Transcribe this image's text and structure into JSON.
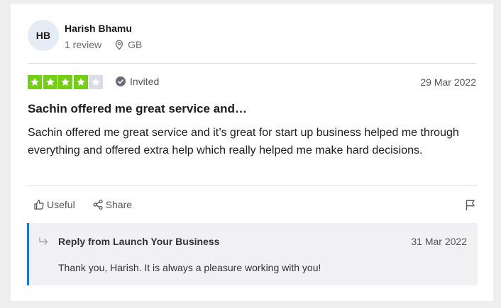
{
  "reviewer": {
    "initials": "HB",
    "name": "Harish Bhamu",
    "review_count": "1 review",
    "location": "GB"
  },
  "review": {
    "rating": 4,
    "max_rating": 5,
    "invited_label": "Invited",
    "date": "29 Mar 2022",
    "title": "Sachin offered me great service and…",
    "body": "Sachin offered me great service and it’s great for start up business helped me through everything and offered extra help which really helped me make hard decisions."
  },
  "actions": {
    "useful_label": "Useful",
    "share_label": "Share"
  },
  "reply": {
    "title": "Reply from Launch Your Business",
    "date": "31 Mar 2022",
    "body": "Thank you, Harish. It is always a pleasure working with you!"
  },
  "colors": {
    "star_on": "#73cf11",
    "star_off": "#dcdce6",
    "reply_accent": "#1a73e8",
    "reply_background": "#f1f1f3"
  },
  "icons": {
    "location": "location-pin-icon",
    "verified": "check-circle-icon",
    "useful": "thumbs-up-icon",
    "share": "share-icon",
    "report": "flag-icon",
    "reply": "reply-arrow-icon"
  }
}
